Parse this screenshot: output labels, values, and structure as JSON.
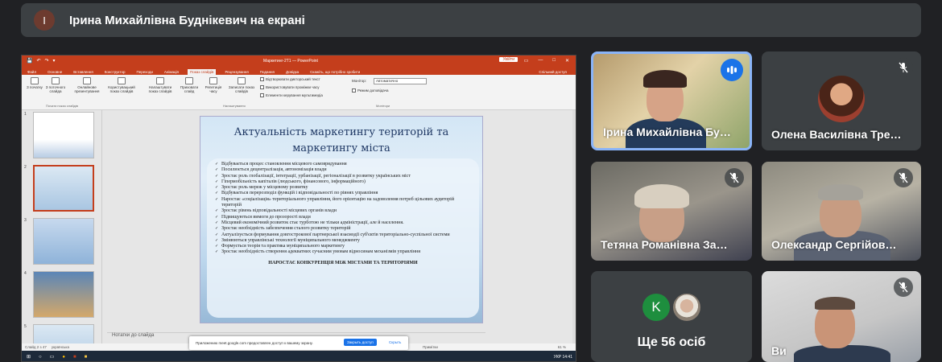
{
  "presenter": {
    "initial": "І",
    "text": "Ірина Михайлівна Буднікевич на екрані"
  },
  "powerpoint": {
    "quick_access": [
      "💾",
      "↶",
      "↷",
      "▾"
    ],
    "document_title": "Маркетинг-2Т1 — PowerPoint",
    "enter_label": "Увійти",
    "window_buttons": [
      "▭",
      "—",
      "□",
      "✕"
    ],
    "tabs": [
      "Файл",
      "Основне",
      "Вставлення",
      "Конструктор",
      "Переходи",
      "Анімація",
      "Показ слайдів",
      "Рецензування",
      "Подання",
      "Довідка",
      "Скажіть, що потрібно зробити"
    ],
    "active_tab_index": 6,
    "share_label": "Спільний доступ",
    "ribbon_buttons": [
      {
        "label": "З початку"
      },
      {
        "label": "З поточного слайда"
      },
      {
        "label": "Онлайнове презентування"
      },
      {
        "label": "Користувацький показ слайдів"
      },
      {
        "label": "Налаштувати показ слайдів"
      },
      {
        "label": "Приховати слайд"
      },
      {
        "label": "Репетиція часу"
      },
      {
        "label": "Записати показ слайдів"
      }
    ],
    "ribbon_checks": [
      "Відтворювати дикторський текст",
      "Використовувати проміжки часу",
      "Елементи керування мультимедіа"
    ],
    "monitor_label": "Монітор:",
    "monitor_value": "Автоматично",
    "presenter_mode_label": "Режим доповідача",
    "ribbon_groups": [
      "Почати показ слайдів",
      "Налаштування",
      "Монітори"
    ],
    "thumbnail_numbers": [
      "1",
      "2",
      "3",
      "4",
      "5"
    ],
    "slide": {
      "title": "Актуальність маркетингу територій та маркетингу міста",
      "bullets": [
        "Відбувається процес становлення місцевого самоврядування",
        "Посилюється децентралізація, автономізація влади",
        "Зростає роль глобалізації, інтеграції, урбанізації, регіоналізації  в розвитку українських міст",
        "Гіпермобільність капіталів (людського, фінансового, інформаційного)",
        "Зростає роль мереж у місцевому розвитку",
        "Відбувається перерозподіл функцій і відповідальності по рівнях управління",
        "Наростає «соціалізація» територіального управління, його орієнтацію на задоволення потреб цільових аудиторій територій",
        "Зростає рівень відповідальності місцевих органів влади",
        "Підвищуються вимоги до прозорості влади",
        "Місцевий економічний розвиток стає турботою не тільки адміністрації, але й населення.",
        "Зростає необхідність забезпечення сталого розвитку територій",
        "Актуалізується формування довгострокової партнерської взаємодії суб'єктів територіально-суспільної системи",
        "Змінюються управлінські технології муніципального менеджменту",
        "Формується теорія та практика муніципального маркетингу",
        "Зростає необхідність створення адекватних сучасним умовам відносинам механізмів управління"
      ],
      "footer": "НАРОСТАЄ КОНКУРЕНЦІЯ МІЖ МІСТАМИ ТА ТЕРИТОРІЯМИ"
    },
    "notes_placeholder": "Нотатки до слайда",
    "status_slide": "Слайд 2 з 47",
    "status_language": "українська",
    "status_notes": "Нотатки",
    "status_comments": "Примітки",
    "zoom": "61 %",
    "taskbar_time": "14:41",
    "taskbar_lang": "УКР"
  },
  "share_banner": {
    "text": "Приложению meet.google.com предоставлен доступ к вашему экрану.",
    "stop_label": "Закрыть доступ",
    "hide_label": "Скрыть"
  },
  "participants": [
    {
      "name": "Ірина Михайлівна Бу…",
      "state": "speaking"
    },
    {
      "name": "Олена Василівна Тре…",
      "state": "muted"
    },
    {
      "name": "Тетяна Романівна За…",
      "state": "muted"
    },
    {
      "name": "Олександр Сергійов…",
      "state": "muted"
    },
    {
      "name": "Ви",
      "state": "muted"
    }
  ],
  "others": {
    "initial": "K",
    "label": "Ще 56 осіб"
  },
  "colors": {
    "background": "#202124",
    "tile": "#3c4043",
    "ppt_accent": "#c43e1c",
    "speaking_border": "#8ab4f8"
  }
}
